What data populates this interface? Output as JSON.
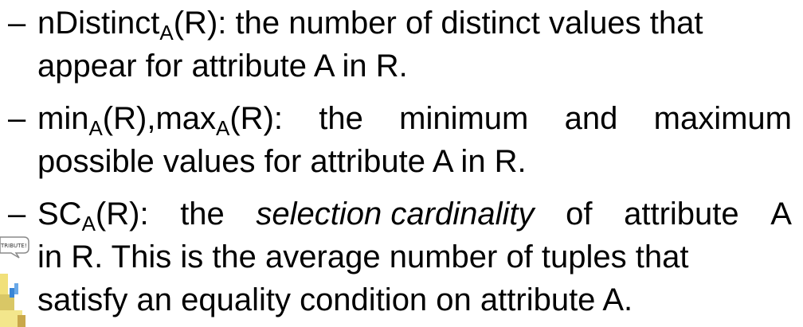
{
  "bullets": [
    {
      "dash": "–",
      "line1_pre": "nDistinct",
      "line1_sub": "A",
      "line1_post": "(R): the number of distinct values that",
      "line2": "appear for attribute A in R."
    },
    {
      "dash": "–",
      "l1_min": "min",
      "l1_min_sub": "A",
      "l1_mid": "(R),max",
      "l1_max_sub": "A",
      "l1_post_a": "(R):",
      "l1_post_b": "the",
      "l1_post_c": "minimum",
      "l1_post_d": "and",
      "l1_post_e": "maximum",
      "line2": "possible values for attribute A in R."
    },
    {
      "dash": "–",
      "l1_sc": "SC",
      "l1_sc_sub": "A",
      "l1_a": "(R):",
      "l1_b": "the",
      "l1_italic": "selection cardinality",
      "l1_c": "of",
      "l1_d": "attribute",
      "l1_e": "A",
      "line2": "in R. This is the average number of tuples that",
      "line3": "satisfy an equality condition on attribute A."
    }
  ],
  "clipart_label": "TRIBUTE!"
}
